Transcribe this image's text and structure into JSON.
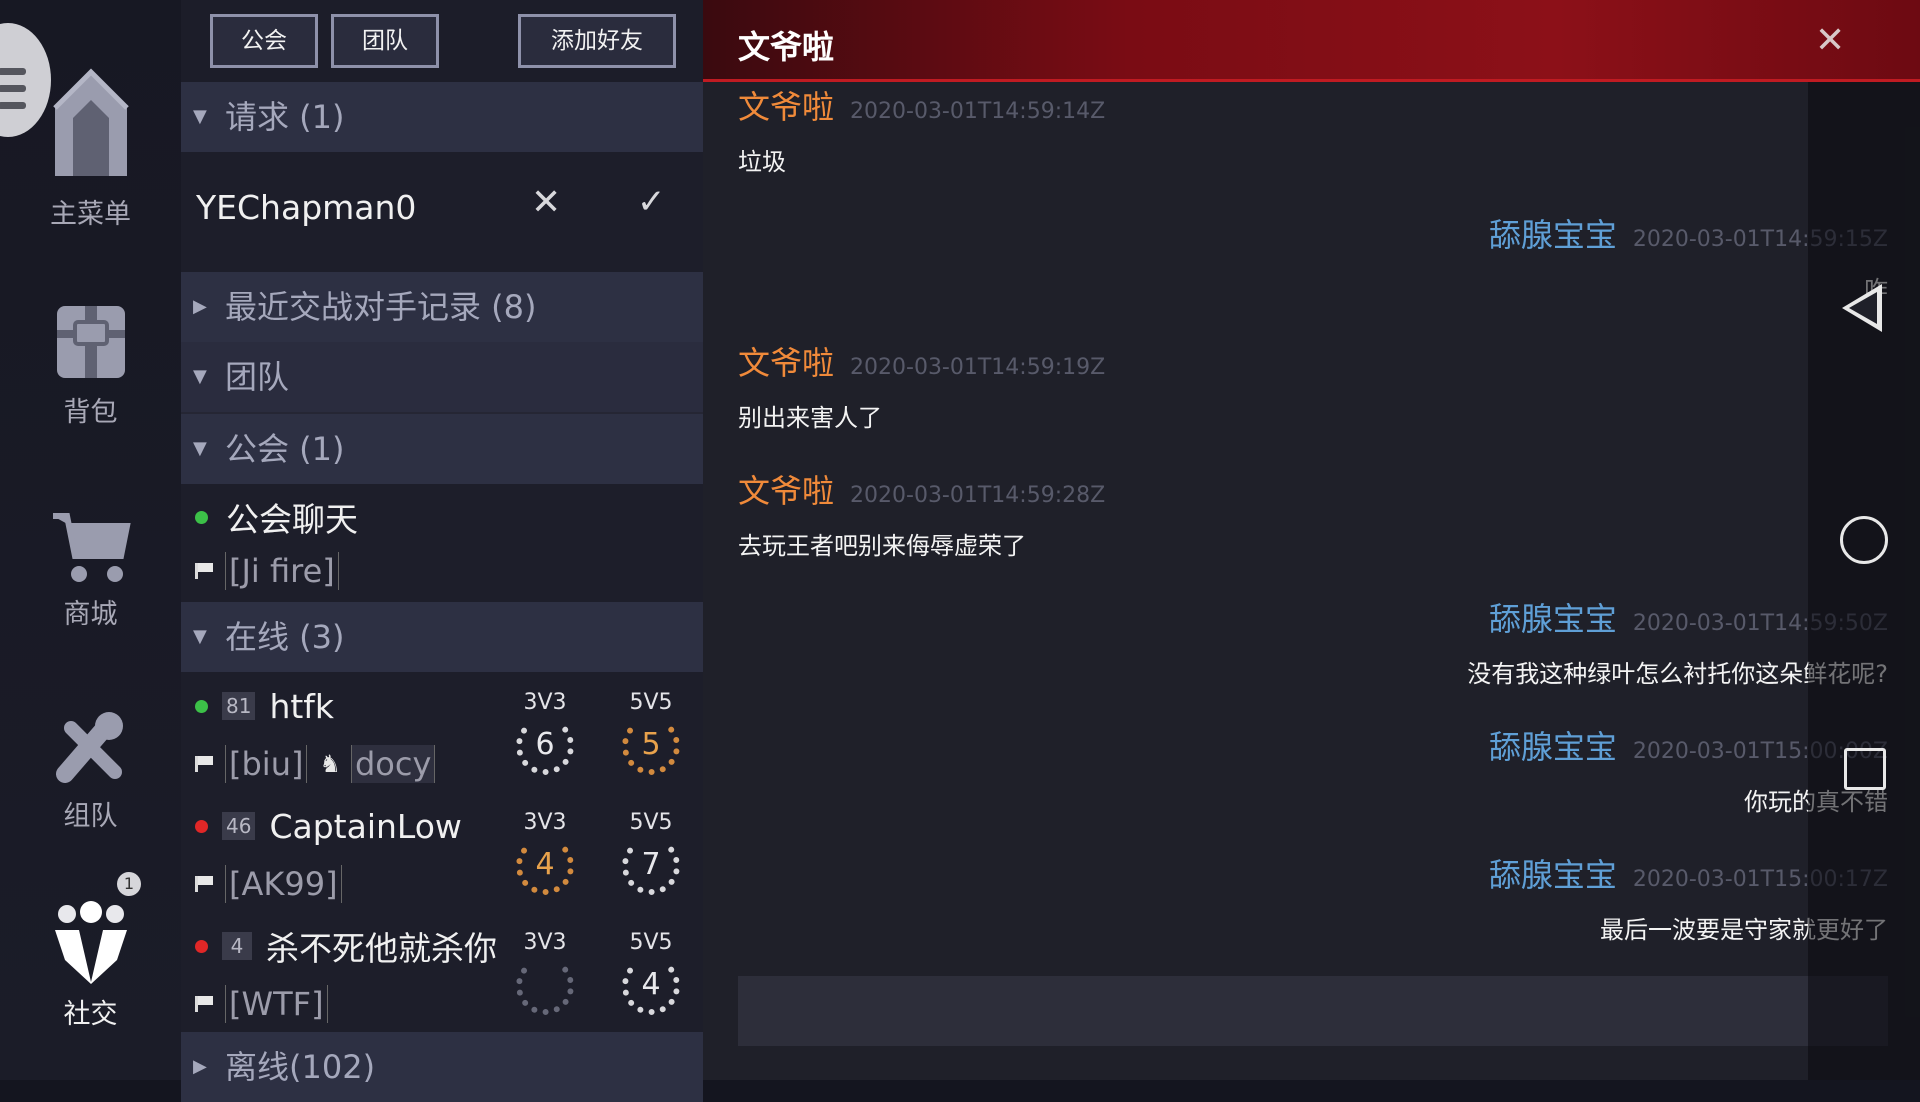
{
  "rail": {
    "items": [
      {
        "label": "主菜单"
      },
      {
        "label": "背包"
      },
      {
        "label": "商城"
      },
      {
        "label": "组队"
      },
      {
        "label": "社交"
      }
    ],
    "notification_count": "1"
  },
  "panel": {
    "tabs": [
      "公会",
      "团队",
      "添加好友"
    ],
    "sections": {
      "requests": "请求 (1)",
      "recent": "最近交战对手记录 (8)",
      "team": "团队",
      "guild": "公会 (1)",
      "online": "在线 (3)",
      "offline": "离线(102)"
    },
    "request": {
      "name": "YEChapman0"
    },
    "guild": {
      "chat_label": "公会聊天",
      "tag": "[Ji fire]"
    },
    "friends": [
      {
        "status": "online",
        "level": "81",
        "name": "htfk",
        "tag": "[biu]",
        "extra": "docy",
        "m3v3_label": "3V3",
        "m3v3": "6",
        "m3v3_style": "silver",
        "m5v5_label": "5V5",
        "m5v5": "5",
        "m5v5_style": "gold"
      },
      {
        "status": "busy",
        "level": "46",
        "name": "CaptainLow",
        "tag": "[AK99]",
        "extra": "",
        "m3v3_label": "3V3",
        "m3v3": "4",
        "m3v3_style": "gold",
        "m5v5_label": "5V5",
        "m5v5": "7",
        "m5v5_style": "silver"
      },
      {
        "status": "busy",
        "level": "4",
        "name": "杀不死他就杀你",
        "tag": "[WTF]",
        "extra": "",
        "m3v3_label": "3V3",
        "m3v3": "",
        "m3v3_style": "empty",
        "m5v5_label": "5V5",
        "m5v5": "4",
        "m5v5_style": "silver"
      }
    ]
  },
  "chat": {
    "title": "文爷啦",
    "messages": [
      {
        "side": "left",
        "sender": "文爷啦",
        "time": "2020-03-01T14:59:14Z",
        "text": "垃圾"
      },
      {
        "side": "right",
        "sender": "舔腺宝宝",
        "time": "2020-03-01T14:59:15Z",
        "text": "咋"
      },
      {
        "side": "left",
        "sender": "文爷啦",
        "time": "2020-03-01T14:59:19Z",
        "text": "别出来害人了"
      },
      {
        "side": "left",
        "sender": "文爷啦",
        "time": "2020-03-01T14:59:28Z",
        "text": "去玩王者吧别来侮辱虚荣了"
      },
      {
        "side": "right",
        "sender": "舔腺宝宝",
        "time": "2020-03-01T14:59:50Z",
        "text": "没有我这种绿叶怎么衬托你这朵鲜花呢?"
      },
      {
        "side": "right",
        "sender": "舔腺宝宝",
        "time": "2020-03-01T15:00:00Z",
        "text": "你玩的真不错"
      },
      {
        "side": "right",
        "sender": "舔腺宝宝",
        "time": "2020-03-01T15:00:17Z",
        "text": "最后一波要是守家就更好了"
      }
    ],
    "input_placeholder": ""
  },
  "colors": {
    "accent_red": "#8c1018",
    "sender_orange": "#f08a3a",
    "sender_blue": "#5f9fd6",
    "online_green": "#3cc048",
    "busy_red": "#e02727"
  }
}
